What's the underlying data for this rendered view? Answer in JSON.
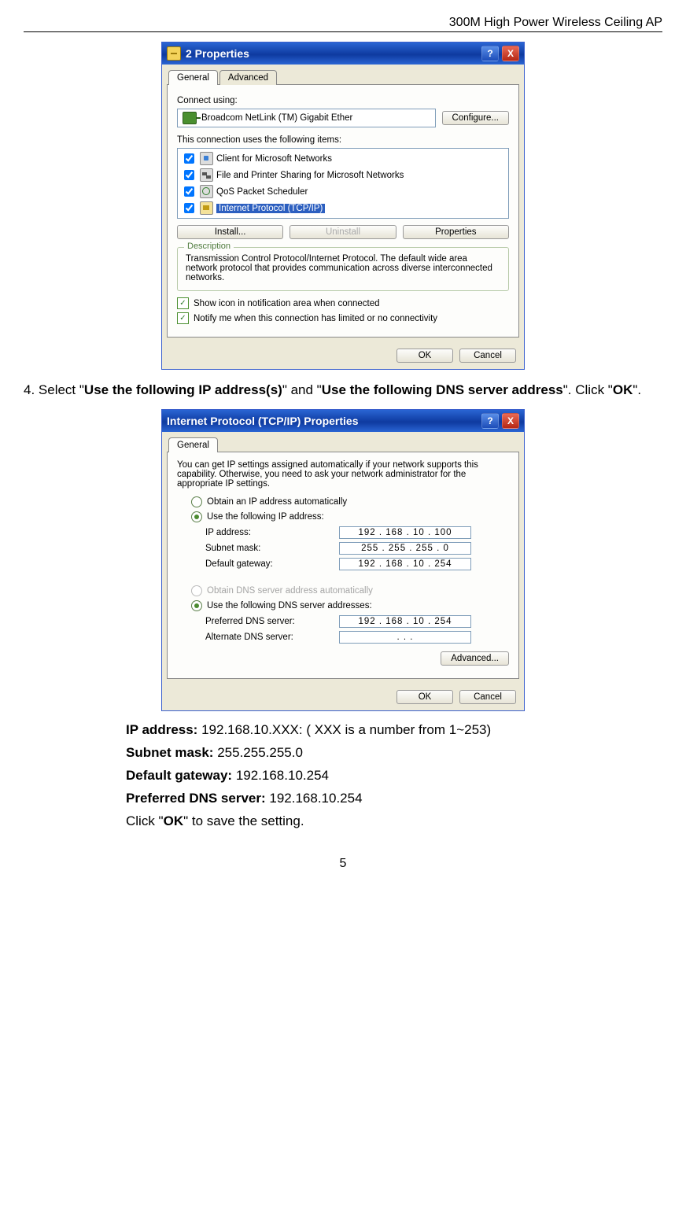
{
  "header_title": "300M High Power Wireless Ceiling AP",
  "page_number": "5",
  "dialog1": {
    "title": "2 Properties",
    "help": "?",
    "close": "X",
    "tab_general": "General",
    "tab_advanced": "Advanced",
    "connect_using": "Connect using:",
    "adapter": "Broadcom NetLink (TM) Gigabit Ether",
    "btn_configure": "Configure...",
    "items_label": "This connection uses the following items:",
    "item1": "Client for Microsoft Networks",
    "item2": "File and Printer Sharing for Microsoft Networks",
    "item3": "QoS Packet Scheduler",
    "item4": "Internet Protocol (TCP/IP)",
    "btn_install": "Install...",
    "btn_uninstall": "Uninstall",
    "btn_properties": "Properties",
    "desc_legend": "Description",
    "desc_text": "Transmission Control Protocol/Internet Protocol. The default wide area network protocol that provides communication across diverse interconnected networks.",
    "chk_show": "Show icon in notification area when connected",
    "chk_notify": "Notify me when this connection has limited or no connectivity",
    "btn_ok": "OK",
    "btn_cancel": "Cancel"
  },
  "body_text": {
    "p1a": "4. Select \"",
    "p1b": "Use the following IP address(s)",
    "p1c": "\" and \"",
    "p1d": "Use the following DNS server address",
    "p1e": "\". Click \"",
    "p1f": "OK",
    "p1g": "\"."
  },
  "dialog2": {
    "title": "Internet Protocol (TCP/IP) Properties",
    "help": "?",
    "close": "X",
    "tab_general": "General",
    "intro": "You can get IP settings assigned automatically if your network supports this capability. Otherwise, you need to ask your network administrator for the appropriate IP settings.",
    "r_obtain_ip": "Obtain an IP address automatically",
    "r_use_ip": "Use the following IP address:",
    "ip_label": "IP address:",
    "ip_value": "192 . 168 .  10  . 100",
    "mask_label": "Subnet mask:",
    "mask_value": "255 . 255 . 255 .   0",
    "gw_label": "Default gateway:",
    "gw_value": "192 . 168 .  10  . 254",
    "r_obtain_dns": "Obtain DNS server address automatically",
    "r_use_dns": "Use the following DNS server addresses:",
    "pdns_label": "Preferred DNS server:",
    "pdns_value": "192 . 168 .  10  . 254",
    "adns_label": "Alternate DNS server:",
    "adns_value": ".       .       .",
    "btn_advanced": "Advanced...",
    "btn_ok": "OK",
    "btn_cancel": "Cancel"
  },
  "notes": {
    "ip_bold": "IP address: ",
    "ip_rest": "192.168.10.XXX: ( XXX is a number from 1~253)",
    "mask_bold": "Subnet mask: ",
    "mask_rest": "255.255.255.0",
    "gw_bold": "Default gateway: ",
    "gw_rest": "192.168.10.254",
    "pdns_bold": "Preferred DNS server: ",
    "pdns_rest": "192.168.10.254",
    "click_a": "Click \"",
    "click_b": "OK",
    "click_c": "\" to save the setting."
  }
}
